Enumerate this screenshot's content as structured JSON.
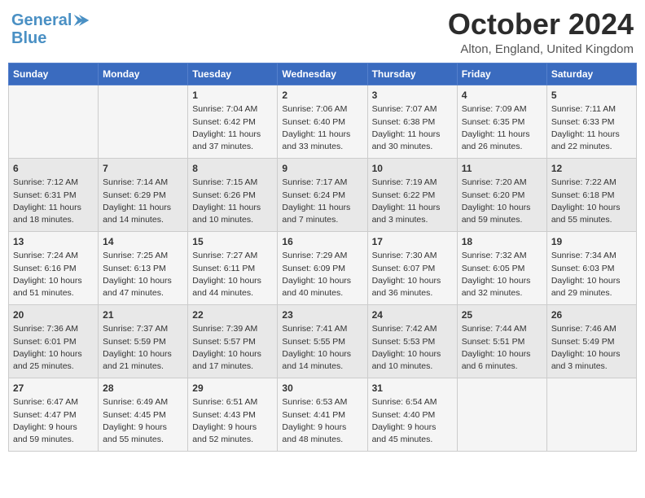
{
  "header": {
    "logo_line1": "General",
    "logo_line2": "Blue",
    "month": "October 2024",
    "location": "Alton, England, United Kingdom"
  },
  "days_of_week": [
    "Sunday",
    "Monday",
    "Tuesday",
    "Wednesday",
    "Thursday",
    "Friday",
    "Saturday"
  ],
  "weeks": [
    [
      {
        "day": "",
        "info": ""
      },
      {
        "day": "",
        "info": ""
      },
      {
        "day": "1",
        "info": "Sunrise: 7:04 AM\nSunset: 6:42 PM\nDaylight: 11 hours and 37 minutes."
      },
      {
        "day": "2",
        "info": "Sunrise: 7:06 AM\nSunset: 6:40 PM\nDaylight: 11 hours and 33 minutes."
      },
      {
        "day": "3",
        "info": "Sunrise: 7:07 AM\nSunset: 6:38 PM\nDaylight: 11 hours and 30 minutes."
      },
      {
        "day": "4",
        "info": "Sunrise: 7:09 AM\nSunset: 6:35 PM\nDaylight: 11 hours and 26 minutes."
      },
      {
        "day": "5",
        "info": "Sunrise: 7:11 AM\nSunset: 6:33 PM\nDaylight: 11 hours and 22 minutes."
      }
    ],
    [
      {
        "day": "6",
        "info": "Sunrise: 7:12 AM\nSunset: 6:31 PM\nDaylight: 11 hours and 18 minutes."
      },
      {
        "day": "7",
        "info": "Sunrise: 7:14 AM\nSunset: 6:29 PM\nDaylight: 11 hours and 14 minutes."
      },
      {
        "day": "8",
        "info": "Sunrise: 7:15 AM\nSunset: 6:26 PM\nDaylight: 11 hours and 10 minutes."
      },
      {
        "day": "9",
        "info": "Sunrise: 7:17 AM\nSunset: 6:24 PM\nDaylight: 11 hours and 7 minutes."
      },
      {
        "day": "10",
        "info": "Sunrise: 7:19 AM\nSunset: 6:22 PM\nDaylight: 11 hours and 3 minutes."
      },
      {
        "day": "11",
        "info": "Sunrise: 7:20 AM\nSunset: 6:20 PM\nDaylight: 10 hours and 59 minutes."
      },
      {
        "day": "12",
        "info": "Sunrise: 7:22 AM\nSunset: 6:18 PM\nDaylight: 10 hours and 55 minutes."
      }
    ],
    [
      {
        "day": "13",
        "info": "Sunrise: 7:24 AM\nSunset: 6:16 PM\nDaylight: 10 hours and 51 minutes."
      },
      {
        "day": "14",
        "info": "Sunrise: 7:25 AM\nSunset: 6:13 PM\nDaylight: 10 hours and 47 minutes."
      },
      {
        "day": "15",
        "info": "Sunrise: 7:27 AM\nSunset: 6:11 PM\nDaylight: 10 hours and 44 minutes."
      },
      {
        "day": "16",
        "info": "Sunrise: 7:29 AM\nSunset: 6:09 PM\nDaylight: 10 hours and 40 minutes."
      },
      {
        "day": "17",
        "info": "Sunrise: 7:30 AM\nSunset: 6:07 PM\nDaylight: 10 hours and 36 minutes."
      },
      {
        "day": "18",
        "info": "Sunrise: 7:32 AM\nSunset: 6:05 PM\nDaylight: 10 hours and 32 minutes."
      },
      {
        "day": "19",
        "info": "Sunrise: 7:34 AM\nSunset: 6:03 PM\nDaylight: 10 hours and 29 minutes."
      }
    ],
    [
      {
        "day": "20",
        "info": "Sunrise: 7:36 AM\nSunset: 6:01 PM\nDaylight: 10 hours and 25 minutes."
      },
      {
        "day": "21",
        "info": "Sunrise: 7:37 AM\nSunset: 5:59 PM\nDaylight: 10 hours and 21 minutes."
      },
      {
        "day": "22",
        "info": "Sunrise: 7:39 AM\nSunset: 5:57 PM\nDaylight: 10 hours and 17 minutes."
      },
      {
        "day": "23",
        "info": "Sunrise: 7:41 AM\nSunset: 5:55 PM\nDaylight: 10 hours and 14 minutes."
      },
      {
        "day": "24",
        "info": "Sunrise: 7:42 AM\nSunset: 5:53 PM\nDaylight: 10 hours and 10 minutes."
      },
      {
        "day": "25",
        "info": "Sunrise: 7:44 AM\nSunset: 5:51 PM\nDaylight: 10 hours and 6 minutes."
      },
      {
        "day": "26",
        "info": "Sunrise: 7:46 AM\nSunset: 5:49 PM\nDaylight: 10 hours and 3 minutes."
      }
    ],
    [
      {
        "day": "27",
        "info": "Sunrise: 6:47 AM\nSunset: 4:47 PM\nDaylight: 9 hours and 59 minutes."
      },
      {
        "day": "28",
        "info": "Sunrise: 6:49 AM\nSunset: 4:45 PM\nDaylight: 9 hours and 55 minutes."
      },
      {
        "day": "29",
        "info": "Sunrise: 6:51 AM\nSunset: 4:43 PM\nDaylight: 9 hours and 52 minutes."
      },
      {
        "day": "30",
        "info": "Sunrise: 6:53 AM\nSunset: 4:41 PM\nDaylight: 9 hours and 48 minutes."
      },
      {
        "day": "31",
        "info": "Sunrise: 6:54 AM\nSunset: 4:40 PM\nDaylight: 9 hours and 45 minutes."
      },
      {
        "day": "",
        "info": ""
      },
      {
        "day": "",
        "info": ""
      }
    ]
  ]
}
